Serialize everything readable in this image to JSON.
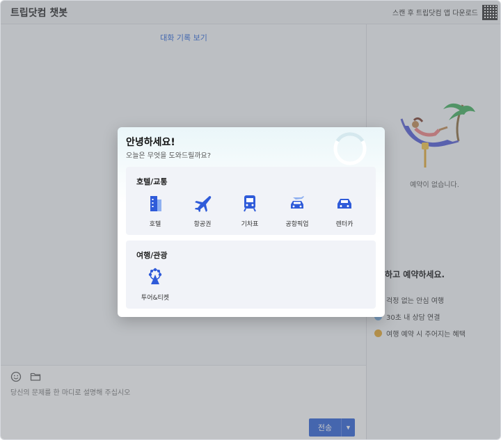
{
  "app": {
    "title": "트립닷컴 챗봇",
    "qr_text": "스캔 후 트립닷컴 앱 다운로드"
  },
  "chat": {
    "history_link": "대화 기록 보기"
  },
  "composer": {
    "placeholder": "당신의 문제를 한 마디로 설명해 주십시오",
    "send_label": "전송"
  },
  "side": {
    "empty_text": "예약이 없습니다.",
    "slogan": "심하고 예약하세요.",
    "benefits": [
      "걱정 없는 안심 여행",
      "30초 내 상담 연결",
      "여행 예약 시 주어지는 혜택"
    ],
    "benefit_colors": [
      "#7fb6e8",
      "#7fb6e8",
      "#e7a82c"
    ]
  },
  "modal": {
    "greeting": "안녕하세요!",
    "subtitle": "오늘은 무엇을 도와드릴까요?",
    "sections": [
      {
        "title": "호텔/교통",
        "items": [
          {
            "label": "호텔",
            "icon": "hotel-icon"
          },
          {
            "label": "항공권",
            "icon": "airplane-icon"
          },
          {
            "label": "기차표",
            "icon": "train-icon"
          },
          {
            "label": "공항픽업",
            "icon": "airport-pickup-icon"
          },
          {
            "label": "렌터카",
            "icon": "car-rental-icon"
          }
        ]
      },
      {
        "title": "여행/관광",
        "items": [
          {
            "label": "투어&티켓",
            "icon": "tour-ticket-icon"
          }
        ]
      }
    ]
  },
  "colors": {
    "accent": "#2a5fd6",
    "link": "#2a65d8",
    "overlay": "rgba(108,112,120,0.42)"
  }
}
